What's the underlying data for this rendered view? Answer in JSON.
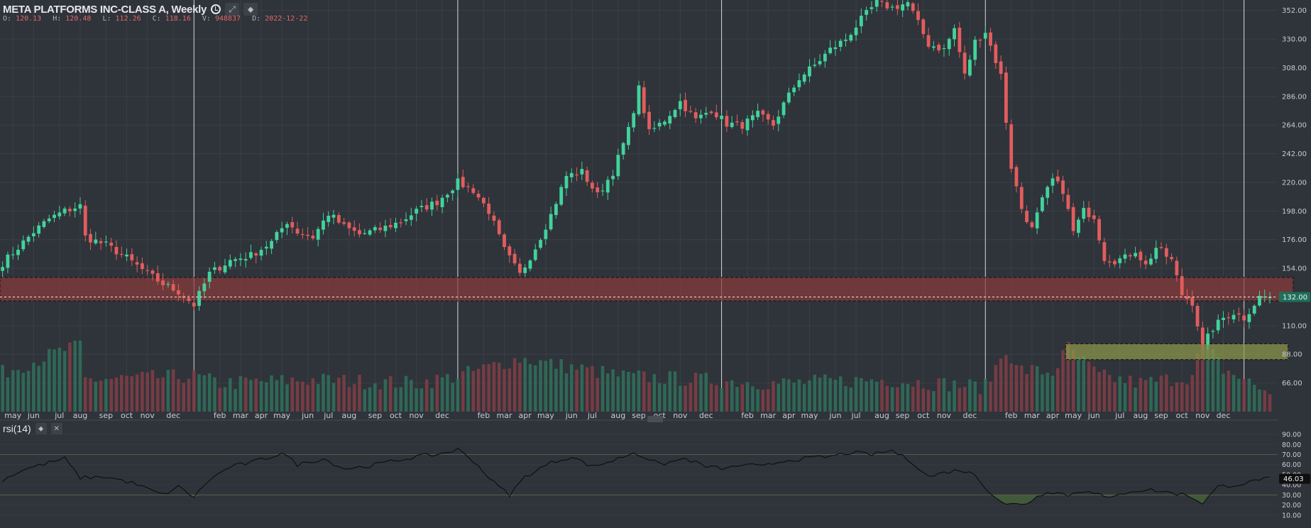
{
  "header": {
    "title": "META PLATFORMS INC-CLASS A, Weekly",
    "ohlc": {
      "O": "120.13",
      "H": "120.48",
      "L": "112.26",
      "C": "118.16",
      "V": "948837",
      "D": "2022-12-22"
    }
  },
  "indicator": {
    "title": "rsi(14)"
  },
  "colors": {
    "up": "#41d39c",
    "down": "#e25d5d",
    "bg": "#2f333a",
    "grid": "#3b4047",
    "zone_red": "#8a3a3a",
    "zone_green": "#8f9a4a"
  },
  "chart_data": [
    {
      "type": "candlestick",
      "title": "META PLATFORMS INC-CLASS A, Weekly",
      "ylim": [
        44,
        360
      ],
      "yticks": [
        66,
        88,
        110,
        132,
        154,
        176,
        198,
        220,
        242,
        264,
        286,
        308,
        330,
        352
      ],
      "ytick_labels": [
        "66.00",
        "88.00",
        "110.00",
        "132.00",
        "154.00",
        "176.00",
        "198.00",
        "220.00",
        "242.00",
        "264.00",
        "286.00",
        "308.00",
        "330.00",
        "352.00"
      ],
      "price_label": "132.00",
      "xtick_labels": [
        {
          "i": 2,
          "label": "may"
        },
        {
          "i": 6,
          "label": "jun"
        },
        {
          "i": 11,
          "label": "jul"
        },
        {
          "i": 15,
          "label": "aug"
        },
        {
          "i": 20,
          "label": "sep"
        },
        {
          "i": 24,
          "label": "oct"
        },
        {
          "i": 28,
          "label": "nov"
        },
        {
          "i": 33,
          "label": "dec"
        },
        {
          "i": 42,
          "label": "feb"
        },
        {
          "i": 46,
          "label": "mar"
        },
        {
          "i": 50,
          "label": "apr"
        },
        {
          "i": 54,
          "label": "may"
        },
        {
          "i": 59,
          "label": "jun"
        },
        {
          "i": 63,
          "label": "jul"
        },
        {
          "i": 67,
          "label": "aug"
        },
        {
          "i": 72,
          "label": "sep"
        },
        {
          "i": 76,
          "label": "oct"
        },
        {
          "i": 80,
          "label": "nov"
        },
        {
          "i": 85,
          "label": "dec"
        },
        {
          "i": 93,
          "label": "feb"
        },
        {
          "i": 97,
          "label": "mar"
        },
        {
          "i": 101,
          "label": "apr"
        },
        {
          "i": 105,
          "label": "may"
        },
        {
          "i": 110,
          "label": "jun"
        },
        {
          "i": 114,
          "label": "jul"
        },
        {
          "i": 119,
          "label": "aug"
        },
        {
          "i": 123,
          "label": "sep"
        },
        {
          "i": 127,
          "label": "oct"
        },
        {
          "i": 131,
          "label": "nov"
        },
        {
          "i": 136,
          "label": "dec"
        },
        {
          "i": 144,
          "label": "feb"
        },
        {
          "i": 148,
          "label": "mar"
        },
        {
          "i": 152,
          "label": "apr"
        },
        {
          "i": 156,
          "label": "may"
        },
        {
          "i": 161,
          "label": "jun"
        },
        {
          "i": 165,
          "label": "jul"
        },
        {
          "i": 170,
          "label": "aug"
        },
        {
          "i": 174,
          "label": "sep"
        },
        {
          "i": 178,
          "label": "oct"
        },
        {
          "i": 182,
          "label": "nov"
        },
        {
          "i": 187,
          "label": "dec"
        },
        {
          "i": 195,
          "label": "feb"
        },
        {
          "i": 199,
          "label": "mar"
        },
        {
          "i": 203,
          "label": "apr"
        },
        {
          "i": 207,
          "label": "may"
        },
        {
          "i": 211,
          "label": "jun"
        },
        {
          "i": 216,
          "label": "jul"
        },
        {
          "i": 220,
          "label": "aug"
        },
        {
          "i": 224,
          "label": "sep"
        },
        {
          "i": 228,
          "label": "oct"
        },
        {
          "i": 232,
          "label": "nov"
        },
        {
          "i": 236,
          "label": "dec"
        }
      ],
      "year_lines": [
        37,
        88,
        139,
        190,
        240
      ],
      "zones": [
        {
          "name": "resistance",
          "y0": 129,
          "y1": 147,
          "from": 0,
          "to": 249,
          "color": "#8a3a3a"
        },
        {
          "name": "support",
          "y0": 84,
          "y1": 96,
          "from": 206,
          "to": 248,
          "color": "#8f9a4a"
        }
      ],
      "close_anchors": [
        [
          0,
          158
        ],
        [
          3,
          170
        ],
        [
          6,
          182
        ],
        [
          9,
          192
        ],
        [
          12,
          198
        ],
        [
          15,
          202
        ],
        [
          16,
          178
        ],
        [
          20,
          172
        ],
        [
          24,
          162
        ],
        [
          28,
          150
        ],
        [
          31,
          142
        ],
        [
          34,
          136
        ],
        [
          37,
          126
        ],
        [
          40,
          150
        ],
        [
          44,
          160
        ],
        [
          48,
          164
        ],
        [
          52,
          174
        ],
        [
          55,
          190
        ],
        [
          57,
          182
        ],
        [
          60,
          178
        ],
        [
          63,
          196
        ],
        [
          66,
          186
        ],
        [
          69,
          180
        ],
        [
          73,
          184
        ],
        [
          77,
          190
        ],
        [
          80,
          198
        ],
        [
          84,
          205
        ],
        [
          88,
          220
        ],
        [
          91,
          214
        ],
        [
          94,
          198
        ],
        [
          97,
          168
        ],
        [
          100,
          149
        ],
        [
          103,
          170
        ],
        [
          106,
          195
        ],
        [
          109,
          225
        ],
        [
          112,
          228
        ],
        [
          115,
          210
        ],
        [
          118,
          228
        ],
        [
          121,
          260
        ],
        [
          123,
          292
        ],
        [
          125,
          258
        ],
        [
          128,
          268
        ],
        [
          131,
          282
        ],
        [
          134,
          268
        ],
        [
          137,
          276
        ],
        [
          140,
          265
        ],
        [
          143,
          264
        ],
        [
          146,
          272
        ],
        [
          149,
          264
        ],
        [
          151,
          280
        ],
        [
          154,
          300
        ],
        [
          157,
          310
        ],
        [
          160,
          322
        ],
        [
          163,
          330
        ],
        [
          166,
          345
        ],
        [
          169,
          358
        ],
        [
          172,
          354
        ],
        [
          175,
          358
        ],
        [
          177,
          342
        ],
        [
          179,
          326
        ],
        [
          182,
          322
        ],
        [
          184,
          338
        ],
        [
          186,
          302
        ],
        [
          188,
          328
        ],
        [
          190,
          336
        ],
        [
          193,
          302
        ],
        [
          195,
          232
        ],
        [
          197,
          200
        ],
        [
          199,
          184
        ],
        [
          201,
          206
        ],
        [
          203,
          222
        ],
        [
          205,
          214
        ],
        [
          207,
          182
        ],
        [
          209,
          198
        ],
        [
          211,
          194
        ],
        [
          213,
          162
        ],
        [
          215,
          160
        ],
        [
          217,
          162
        ],
        [
          219,
          168
        ],
        [
          221,
          156
        ],
        [
          223,
          170
        ],
        [
          226,
          160
        ],
        [
          228,
          134
        ],
        [
          230,
          128
        ],
        [
          232,
          94
        ],
        [
          234,
          108
        ],
        [
          236,
          116
        ],
        [
          238,
          120
        ],
        [
          240,
          116
        ],
        [
          243,
          132
        ]
      ],
      "volume_anchors": [
        [
          0,
          0.55
        ],
        [
          15,
          0.95
        ],
        [
          16,
          0.45
        ],
        [
          37,
          0.5
        ],
        [
          42,
          0.4
        ],
        [
          60,
          0.45
        ],
        [
          80,
          0.4
        ],
        [
          88,
          0.5
        ],
        [
          100,
          0.75
        ],
        [
          120,
          0.5
        ],
        [
          150,
          0.4
        ],
        [
          170,
          0.45
        ],
        [
          190,
          0.35
        ],
        [
          194,
          0.9
        ],
        [
          196,
          0.6
        ],
        [
          203,
          0.55
        ],
        [
          206,
          0.9
        ],
        [
          212,
          0.5
        ],
        [
          220,
          0.4
        ],
        [
          225,
          0.45
        ],
        [
          230,
          0.5
        ],
        [
          232,
          1.0
        ],
        [
          236,
          0.6
        ],
        [
          244,
          0.3
        ]
      ],
      "volume_note": "relative weekly volume bars"
    },
    {
      "type": "line",
      "title": "rsi(14)",
      "ylim": [
        0,
        95
      ],
      "yticks": [
        10,
        20,
        30,
        40,
        50,
        60,
        70,
        80,
        90
      ],
      "ytick_labels": [
        "10.00",
        "20.00",
        "30.00",
        "40.00",
        "50.00",
        "60.00",
        "70.00",
        "80.00",
        "90.00"
      ],
      "levels": [
        30,
        70
      ],
      "last_value": "46.03",
      "series": [
        {
          "anchors": [
            [
              0,
              45
            ],
            [
              4,
              55
            ],
            [
              9,
              62
            ],
            [
              12,
              66
            ],
            [
              15,
              47
            ],
            [
              20,
              48
            ],
            [
              25,
              42
            ],
            [
              31,
              30
            ],
            [
              34,
              38
            ],
            [
              37,
              28
            ],
            [
              40,
              45
            ],
            [
              44,
              58
            ],
            [
              48,
              62
            ],
            [
              52,
              68
            ],
            [
              54,
              72
            ],
            [
              57,
              60
            ],
            [
              62,
              66
            ],
            [
              66,
              56
            ],
            [
              70,
              58
            ],
            [
              75,
              63
            ],
            [
              80,
              68
            ],
            [
              84,
              70
            ],
            [
              88,
              75
            ],
            [
              91,
              64
            ],
            [
              95,
              42
            ],
            [
              98,
              30
            ],
            [
              101,
              48
            ],
            [
              106,
              62
            ],
            [
              110,
              68
            ],
            [
              114,
              58
            ],
            [
              118,
              64
            ],
            [
              122,
              72
            ],
            [
              124,
              68
            ],
            [
              127,
              60
            ],
            [
              132,
              66
            ],
            [
              136,
              58
            ],
            [
              140,
              56
            ],
            [
              143,
              60
            ],
            [
              147,
              58
            ],
            [
              151,
              64
            ],
            [
              155,
              66
            ],
            [
              160,
              68
            ],
            [
              164,
              72
            ],
            [
              168,
              70
            ],
            [
              172,
              74
            ],
            [
              176,
              62
            ],
            [
              179,
              48
            ],
            [
              182,
              52
            ],
            [
              185,
              55
            ],
            [
              188,
              50
            ],
            [
              191,
              32
            ],
            [
              194,
              20
            ],
            [
              198,
              22
            ],
            [
              202,
              34
            ],
            [
              206,
              30
            ],
            [
              210,
              35
            ],
            [
              214,
              26
            ],
            [
              218,
              34
            ],
            [
              222,
              35
            ],
            [
              226,
              32
            ],
            [
              229,
              30
            ],
            [
              232,
              22
            ],
            [
              235,
              38
            ],
            [
              238,
              40
            ],
            [
              241,
              42
            ],
            [
              243,
              46
            ]
          ]
        }
      ]
    }
  ]
}
